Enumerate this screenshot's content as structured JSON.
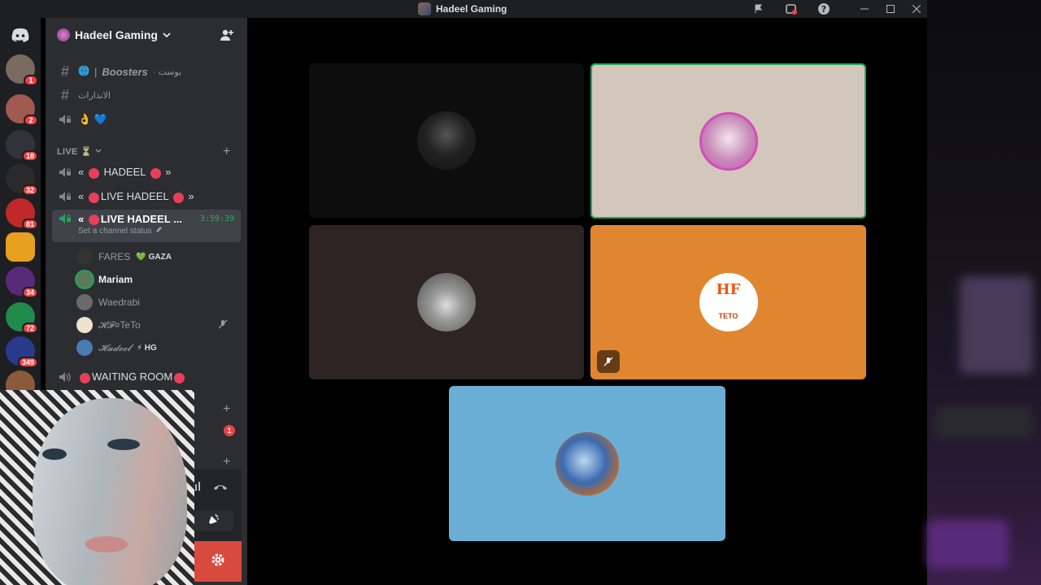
{
  "window": {
    "title": "Hadeel Gaming",
    "icons": [
      "flag-icon",
      "inbox-icon",
      "help-icon",
      "minimize-icon",
      "maximize-icon",
      "close-icon"
    ]
  },
  "servers": [
    {
      "badge": "1",
      "color": "#7a6a60"
    },
    {
      "badge": "2",
      "color": "#a05a50"
    },
    {
      "badge": "18",
      "color": "#30343a"
    },
    {
      "badge": "32",
      "color": "#2a2a2a"
    },
    {
      "badge": "81",
      "color": "#c0282a"
    },
    {
      "badge": "",
      "color": "#e8a020"
    },
    {
      "badge": "34",
      "color": "#5a2a7a"
    },
    {
      "badge": "72",
      "color": "#1f8a4a"
    },
    {
      "badge": "349",
      "color": "#2a3a8a"
    },
    {
      "badge": "",
      "color": "#8a5a3a"
    }
  ],
  "server_header": {
    "name": "Hadeel Gaming"
  },
  "channels": {
    "boosters": {
      "prefix": "| ",
      "name": "Boosters",
      "suffix": "· بوست"
    },
    "warnings": {
      "name": "الانذارات"
    },
    "emoji_channel": {
      "name": "👌 💙"
    },
    "live_category": {
      "name": "LIVE ⏳"
    },
    "voice1": {
      "pre": "« ",
      "name": " HADEEL ",
      "post": " »"
    },
    "voice2": {
      "pre": "« ",
      "name": "LIVE HADEEL ",
      "post": " »"
    },
    "voice3": {
      "pre": "« ",
      "name": "LIVE HADEEL ...",
      "timer": "3:59:39",
      "status": "Set a channel status"
    },
    "waiting": {
      "name": "WAITING ROOM"
    },
    "unread_badge": "1"
  },
  "voice_users": [
    {
      "name": "FARES",
      "tag": "💚 GAZA",
      "color": "#333"
    },
    {
      "name": "Mariam",
      "tag": "",
      "color": "#5a7a5a"
    },
    {
      "name": "Waedrabi",
      "tag": "",
      "color": "#6a6a6a"
    },
    {
      "name": "𝓗𝓕¤TeTo",
      "tag": "",
      "color": "#f0e0d0"
    },
    {
      "name": "𝓗𝓪𝓭𝓮𝓮𝓵",
      "tag": "⚡ HG",
      "color": "#4a7ab0"
    }
  ],
  "tiles": [
    {
      "bg": "#0d0d0d",
      "avatar": "#2a2a2a"
    },
    {
      "bg": "#d3c7bb",
      "avatar": "#d9b9d9"
    },
    {
      "bg": "#2f2424",
      "avatar": "#7a7a7a"
    },
    {
      "bg": "#e08630",
      "avatar": "#ffffff",
      "hf": "HF",
      "label": "TETO"
    },
    {
      "bg": "#6aaed6",
      "avatar": "#3a6ab0"
    }
  ]
}
